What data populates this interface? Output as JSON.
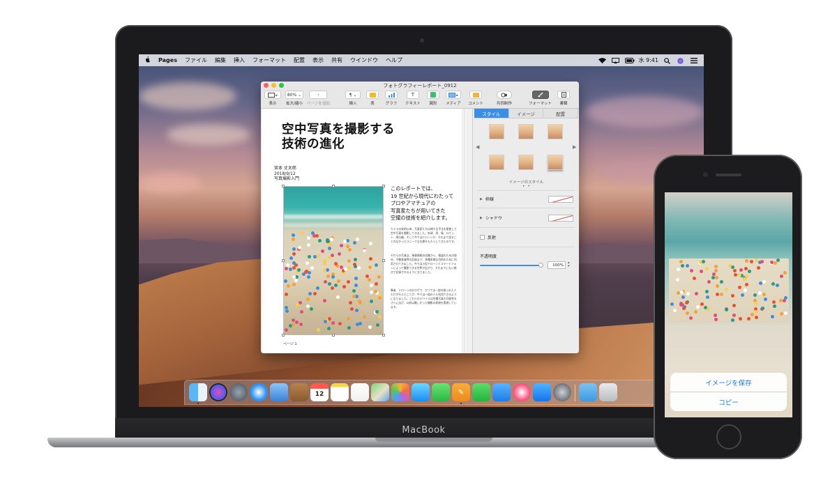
{
  "menubar": {
    "apple": "",
    "app_name": "Pages",
    "items": [
      "ファイル",
      "編集",
      "挿入",
      "フォーマット",
      "配置",
      "表示",
      "共有",
      "ウインドウ",
      "ヘルプ"
    ],
    "clock": "水 9:41"
  },
  "window": {
    "title": "フォトグラフィーレポート_0912",
    "toolbar": {
      "view": "表示",
      "zoom_value": "80%",
      "zoom": "拡大/縮小",
      "add_page": "ページを追加",
      "insert": "挿入",
      "table": "表",
      "chart": "グラフ",
      "text": "テキスト",
      "shape": "図形",
      "media": "メディア",
      "comment": "コメント",
      "collaborate": "共同制作",
      "format": "フォーマット",
      "document": "書類"
    }
  },
  "document": {
    "title_line1": "空中写真を撮影する",
    "title_line2": "技術の進化",
    "author": "宮本 丈太郎",
    "date": "2018/9/12",
    "course": "写真撮影入門",
    "lead_lines": [
      "このレポートでは、",
      "19 世紀から現代にわたって",
      "プロやアマチュアの",
      "写真家たちが用いてきた",
      "空撮の技術を紹介します。"
    ],
    "body_paragraphs": [
      "カメラの発明以来、写真家たちは様々な手法を駆使して空中写真を撮影してきました。気球、凧、鳩、ロケット、飛行機、そして今ではドローンが、それまで見ることのなかったユニークな光景をもたらしてきたのです。",
      "それらの写真は、軍事情報の収集から、報道のための取材、不動産業界の記録まで、多種多様な目的のために利用されてきました。今では小型ドローンとスマートフォンによって撮影できる世界が広がり、それまでにない視点で記録されるようになりました。",
      "筆者、ドローンのおかげで、かつては一部の限られた人だけが行えたことが、今では一般の人も利用できるようになりました。これらのデバイスは空撮写真の可能性をさらに広げ、以前は難しかった撮影の表現を実現しています。"
    ],
    "page_number": "ページ 1"
  },
  "inspector": {
    "tabs": [
      "スタイル",
      "イメージ",
      "配置"
    ],
    "active_tab": "スタイル",
    "caption": "イメージのスタイル",
    "dots": "• •",
    "border": "枠線",
    "shadow": "シャドウ",
    "reflection": "反射",
    "opacity": "不透明度",
    "opacity_value": "100%",
    "opacity_level": 1.0
  },
  "dock": {
    "icons": [
      "finder-icon",
      "siri-icon",
      "launchpad-icon",
      "safari-icon",
      "mail-icon",
      "contacts-icon",
      "calendar-icon",
      "notes-icon",
      "reminders-icon",
      "maps-icon",
      "photos-icon",
      "messages-icon",
      "facetime-icon",
      "pages-icon",
      "numbers-icon",
      "keynote-icon",
      "itunes-icon",
      "app-store-icon",
      "system-preferences-icon",
      "downloads-folder-icon",
      "trash-icon"
    ],
    "calendar_day": "12",
    "pages_glyph": "✎"
  },
  "macbook": {
    "name": "MacBook"
  },
  "iphone": {
    "save_image": "イメージを保存",
    "copy": "コピー"
  },
  "colors": {
    "accent": "#3a8ee6",
    "ios_blue": "#1a7cf0",
    "close": "#fe5f57",
    "minimize": "#febc2e",
    "zoom": "#28c840"
  }
}
